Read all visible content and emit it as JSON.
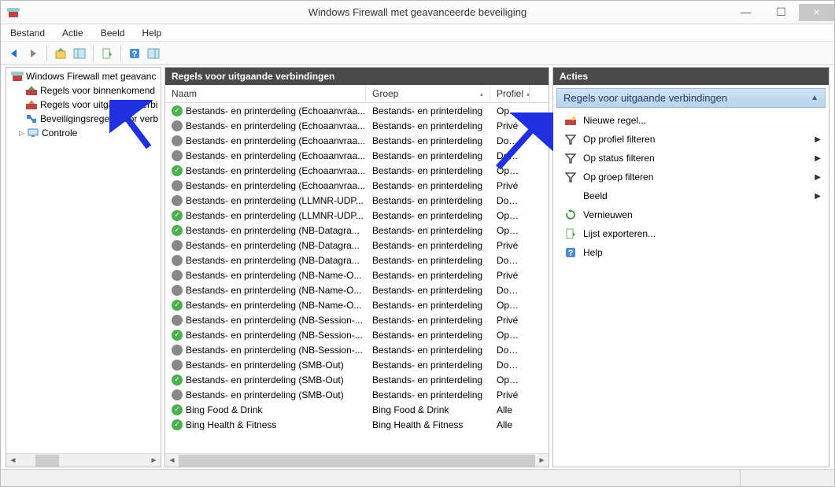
{
  "window": {
    "title": "Windows Firewall met geavanceerde beveiliging"
  },
  "menu": {
    "items": [
      "Bestand",
      "Actie",
      "Beeld",
      "Help"
    ]
  },
  "tree": {
    "root": "Windows Firewall met geavanc",
    "items": [
      {
        "label": "Regels voor binnenkomend",
        "icon": "inbound"
      },
      {
        "label": "Regels voor uitgaande verbi",
        "icon": "outbound"
      },
      {
        "label": "Beveiligingsregels voor verb",
        "icon": "conn"
      },
      {
        "label": "Controle",
        "icon": "monitor",
        "expandable": true
      }
    ]
  },
  "list": {
    "title": "Regels voor uitgaande verbindingen",
    "columns": {
      "name": "Naam",
      "group": "Groep",
      "profile": "Profiel"
    },
    "rows": [
      {
        "enabled": true,
        "name": "Bestands- en printerdeling (Echoaanvraa...",
        "group": "Bestands- en printerdeling",
        "profile": "Openb"
      },
      {
        "enabled": false,
        "name": "Bestands- en printerdeling (Echoaanvraa...",
        "group": "Bestands- en printerdeling",
        "profile": "Privé"
      },
      {
        "enabled": false,
        "name": "Bestands- en printerdeling (Echoaanvraa...",
        "group": "Bestands- en printerdeling",
        "profile": "Domei"
      },
      {
        "enabled": false,
        "name": "Bestands- en printerdeling (Echoaanvraa...",
        "group": "Bestands- en printerdeling",
        "profile": "Domei"
      },
      {
        "enabled": true,
        "name": "Bestands- en printerdeling (Echoaanvraa...",
        "group": "Bestands- en printerdeling",
        "profile": "Openb"
      },
      {
        "enabled": false,
        "name": "Bestands- en printerdeling (Echoaanvraa...",
        "group": "Bestands- en printerdeling",
        "profile": "Privé"
      },
      {
        "enabled": false,
        "name": "Bestands- en printerdeling (LLMNR-UDP...",
        "group": "Bestands- en printerdeling",
        "profile": "Domei"
      },
      {
        "enabled": true,
        "name": "Bestands- en printerdeling (LLMNR-UDP...",
        "group": "Bestands- en printerdeling",
        "profile": "Openb"
      },
      {
        "enabled": true,
        "name": "Bestands- en printerdeling (NB-Datagra...",
        "group": "Bestands- en printerdeling",
        "profile": "Openb"
      },
      {
        "enabled": false,
        "name": "Bestands- en printerdeling (NB-Datagra...",
        "group": "Bestands- en printerdeling",
        "profile": "Privé"
      },
      {
        "enabled": false,
        "name": "Bestands- en printerdeling (NB-Datagra...",
        "group": "Bestands- en printerdeling",
        "profile": "Domei"
      },
      {
        "enabled": false,
        "name": "Bestands- en printerdeling (NB-Name-O...",
        "group": "Bestands- en printerdeling",
        "profile": "Privé"
      },
      {
        "enabled": false,
        "name": "Bestands- en printerdeling (NB-Name-O...",
        "group": "Bestands- en printerdeling",
        "profile": "Domei"
      },
      {
        "enabled": true,
        "name": "Bestands- en printerdeling (NB-Name-O...",
        "group": "Bestands- en printerdeling",
        "profile": "Openb"
      },
      {
        "enabled": false,
        "name": "Bestands- en printerdeling (NB-Session-...",
        "group": "Bestands- en printerdeling",
        "profile": "Privé"
      },
      {
        "enabled": true,
        "name": "Bestands- en printerdeling (NB-Session-...",
        "group": "Bestands- en printerdeling",
        "profile": "Openb"
      },
      {
        "enabled": false,
        "name": "Bestands- en printerdeling (NB-Session-...",
        "group": "Bestands- en printerdeling",
        "profile": "Domei"
      },
      {
        "enabled": false,
        "name": "Bestands- en printerdeling (SMB-Out)",
        "group": "Bestands- en printerdeling",
        "profile": "Domei"
      },
      {
        "enabled": true,
        "name": "Bestands- en printerdeling (SMB-Out)",
        "group": "Bestands- en printerdeling",
        "profile": "Openb"
      },
      {
        "enabled": false,
        "name": "Bestands- en printerdeling (SMB-Out)",
        "group": "Bestands- en printerdeling",
        "profile": "Privé"
      },
      {
        "enabled": true,
        "name": "Bing Food & Drink",
        "group": "Bing Food & Drink",
        "profile": "Alle"
      },
      {
        "enabled": true,
        "name": "Bing Health & Fitness",
        "group": "Bing Health & Fitness",
        "profile": "Alle"
      }
    ]
  },
  "actions": {
    "title": "Acties",
    "heading": "Regels voor uitgaande verbindingen",
    "items": [
      {
        "label": "Nieuwe regel...",
        "icon": "new-rule",
        "arrow": false
      },
      {
        "label": "Op profiel filteren",
        "icon": "filter",
        "arrow": true
      },
      {
        "label": "Op status filteren",
        "icon": "filter",
        "arrow": true
      },
      {
        "label": "Op groep filteren",
        "icon": "filter",
        "arrow": true
      },
      {
        "label": "Beeld",
        "icon": "",
        "arrow": true
      },
      {
        "label": "Vernieuwen",
        "icon": "refresh",
        "arrow": false
      },
      {
        "label": "Lijst exporteren...",
        "icon": "export",
        "arrow": false
      },
      {
        "label": "Help",
        "icon": "help",
        "arrow": false
      }
    ]
  }
}
